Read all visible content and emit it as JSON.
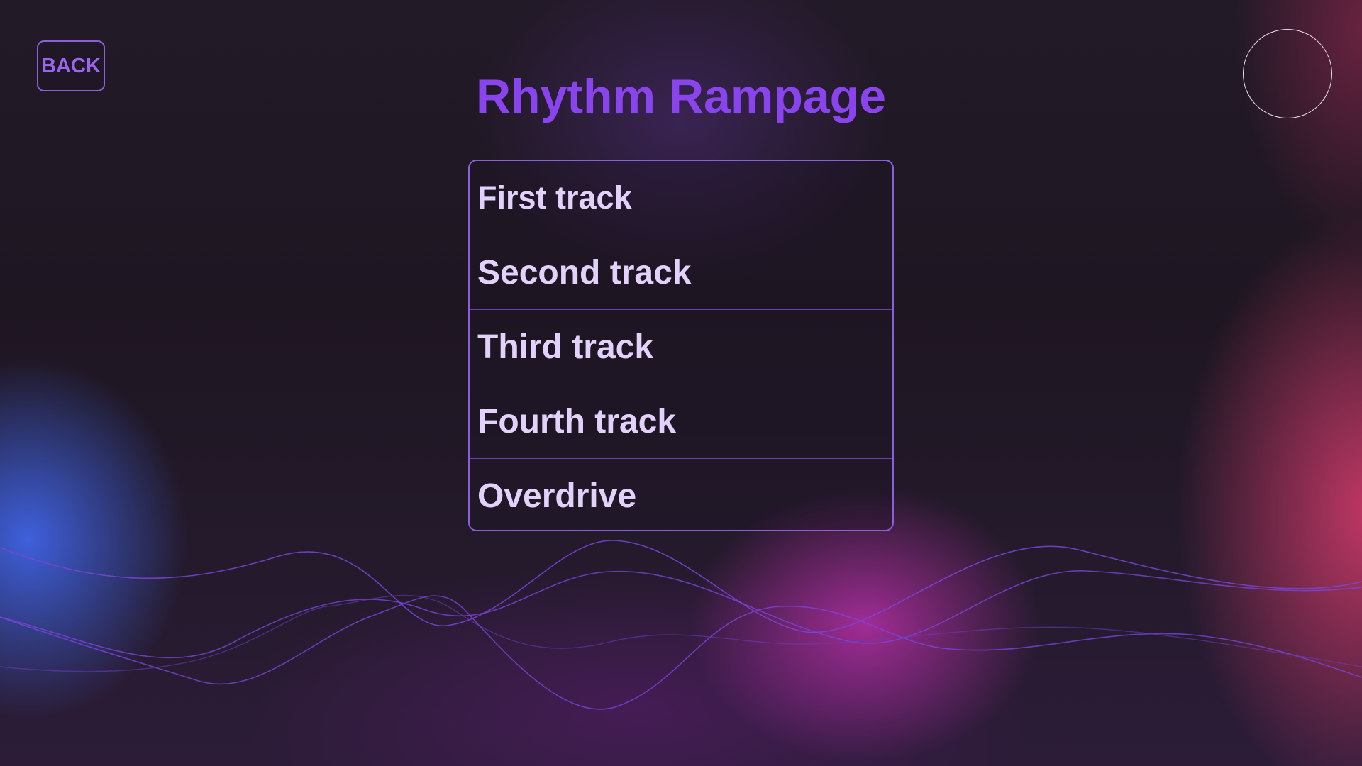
{
  "header": {
    "back_label": "BACK",
    "title": "Rhythm Rampage"
  },
  "tracks": [
    {
      "label": "First track"
    },
    {
      "label": "Second track"
    },
    {
      "label": "Third track"
    },
    {
      "label": "Fourth track"
    },
    {
      "label": "Overdrive"
    }
  ],
  "colors": {
    "accent": "#8a44ee",
    "border": "#8a5fd8",
    "track_text": "#e2d2fb",
    "background": "#1e1722"
  }
}
